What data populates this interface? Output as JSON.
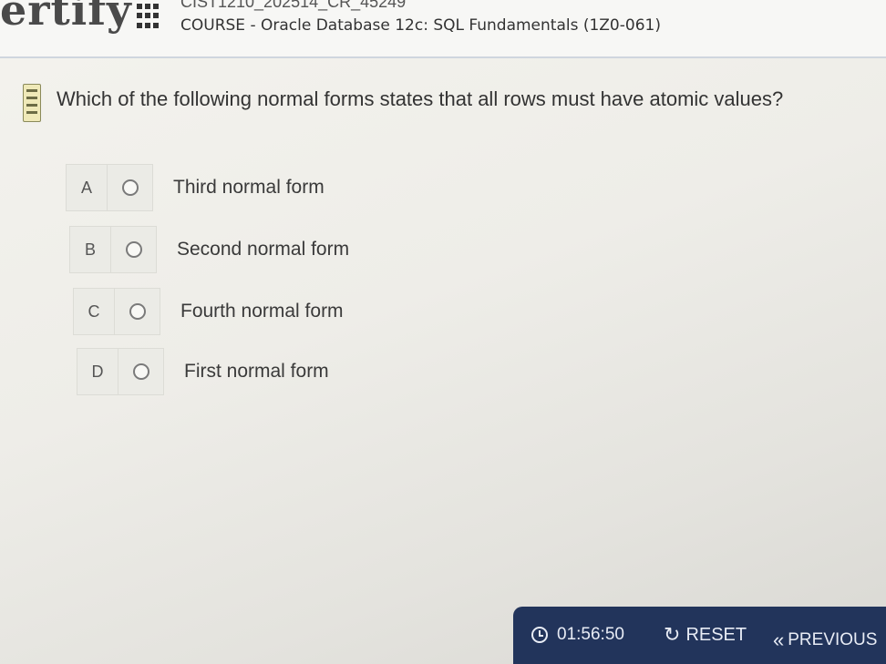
{
  "header": {
    "logo_text": "ertify",
    "exam_code": "CIST1210_202514_CR_45249",
    "course_title": "COURSE - Oracle Database 12c: SQL Fundamentals (1Z0-061)"
  },
  "question": {
    "text": "Which of the following normal forms states that all rows must have atomic values?",
    "options": [
      {
        "letter": "A",
        "label": "Third normal form"
      },
      {
        "letter": "B",
        "label": "Second normal form"
      },
      {
        "letter": "C",
        "label": "Fourth normal form"
      },
      {
        "letter": "D",
        "label": "First normal form"
      }
    ]
  },
  "footer": {
    "timer": "01:56:50",
    "reset_label": "RESET",
    "previous_label": "PREVIOUS"
  },
  "colors": {
    "bar_background": "#22345b",
    "bar_text": "#e8ecf5"
  }
}
